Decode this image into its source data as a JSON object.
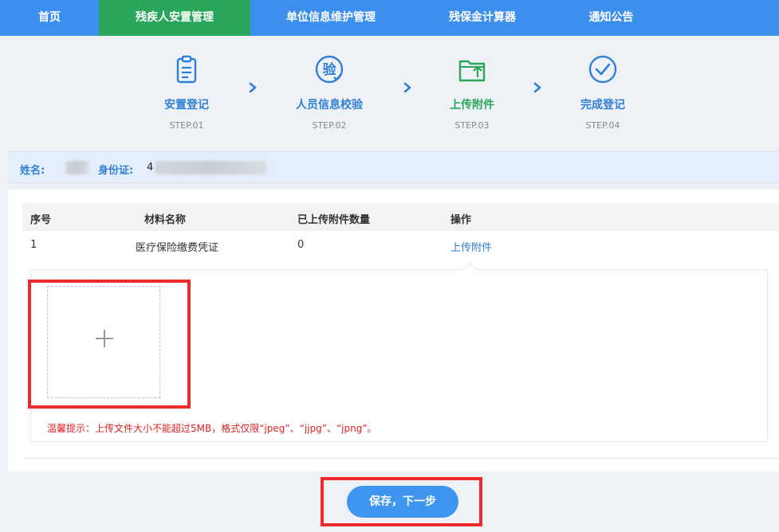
{
  "nav": {
    "items": [
      {
        "label": "首页",
        "active": false
      },
      {
        "label": "残疾人安置管理",
        "active": true
      },
      {
        "label": "单位信息维护管理",
        "active": false
      },
      {
        "label": "残保金计算器",
        "active": false
      },
      {
        "label": "通知公告",
        "active": false
      }
    ]
  },
  "steps": [
    {
      "label": "安置登记",
      "sub": "STEP.01",
      "icon": "clipboard-icon"
    },
    {
      "label": "人员信息校验",
      "sub": "STEP.02",
      "icon": "verify-seal-icon",
      "icon_text": "验"
    },
    {
      "label": "上传附件",
      "sub": "STEP.03",
      "icon": "folder-upload-icon"
    },
    {
      "label": "完成登记",
      "sub": "STEP.04",
      "icon": "check-circle-icon"
    }
  ],
  "info": {
    "name_label": "姓名:",
    "id_label": "身份证:",
    "id_value_visible": "4"
  },
  "table": {
    "headers": [
      "序号",
      "材料名称",
      "已上传附件数量",
      "操作"
    ],
    "rows": [
      {
        "index": "1",
        "name": "医疗保险缴费凭证",
        "count": "0",
        "action": "上传附件"
      }
    ]
  },
  "upload": {
    "tip": "温馨提示：上传文件大小不能超过5MB，格式仅限“jpeg”、“jjpg”、“jpng”。"
  },
  "footer": {
    "save_label": "保存，下一步"
  },
  "colors": {
    "nav_bg": "#3d8fed",
    "nav_active": "#29a65a",
    "step_blue": "#2f7ed8",
    "step_current": "#29a65a",
    "tip_red": "#e02020",
    "highlight_red": "#ee2a2a",
    "button_blue": "#3d95f0"
  }
}
